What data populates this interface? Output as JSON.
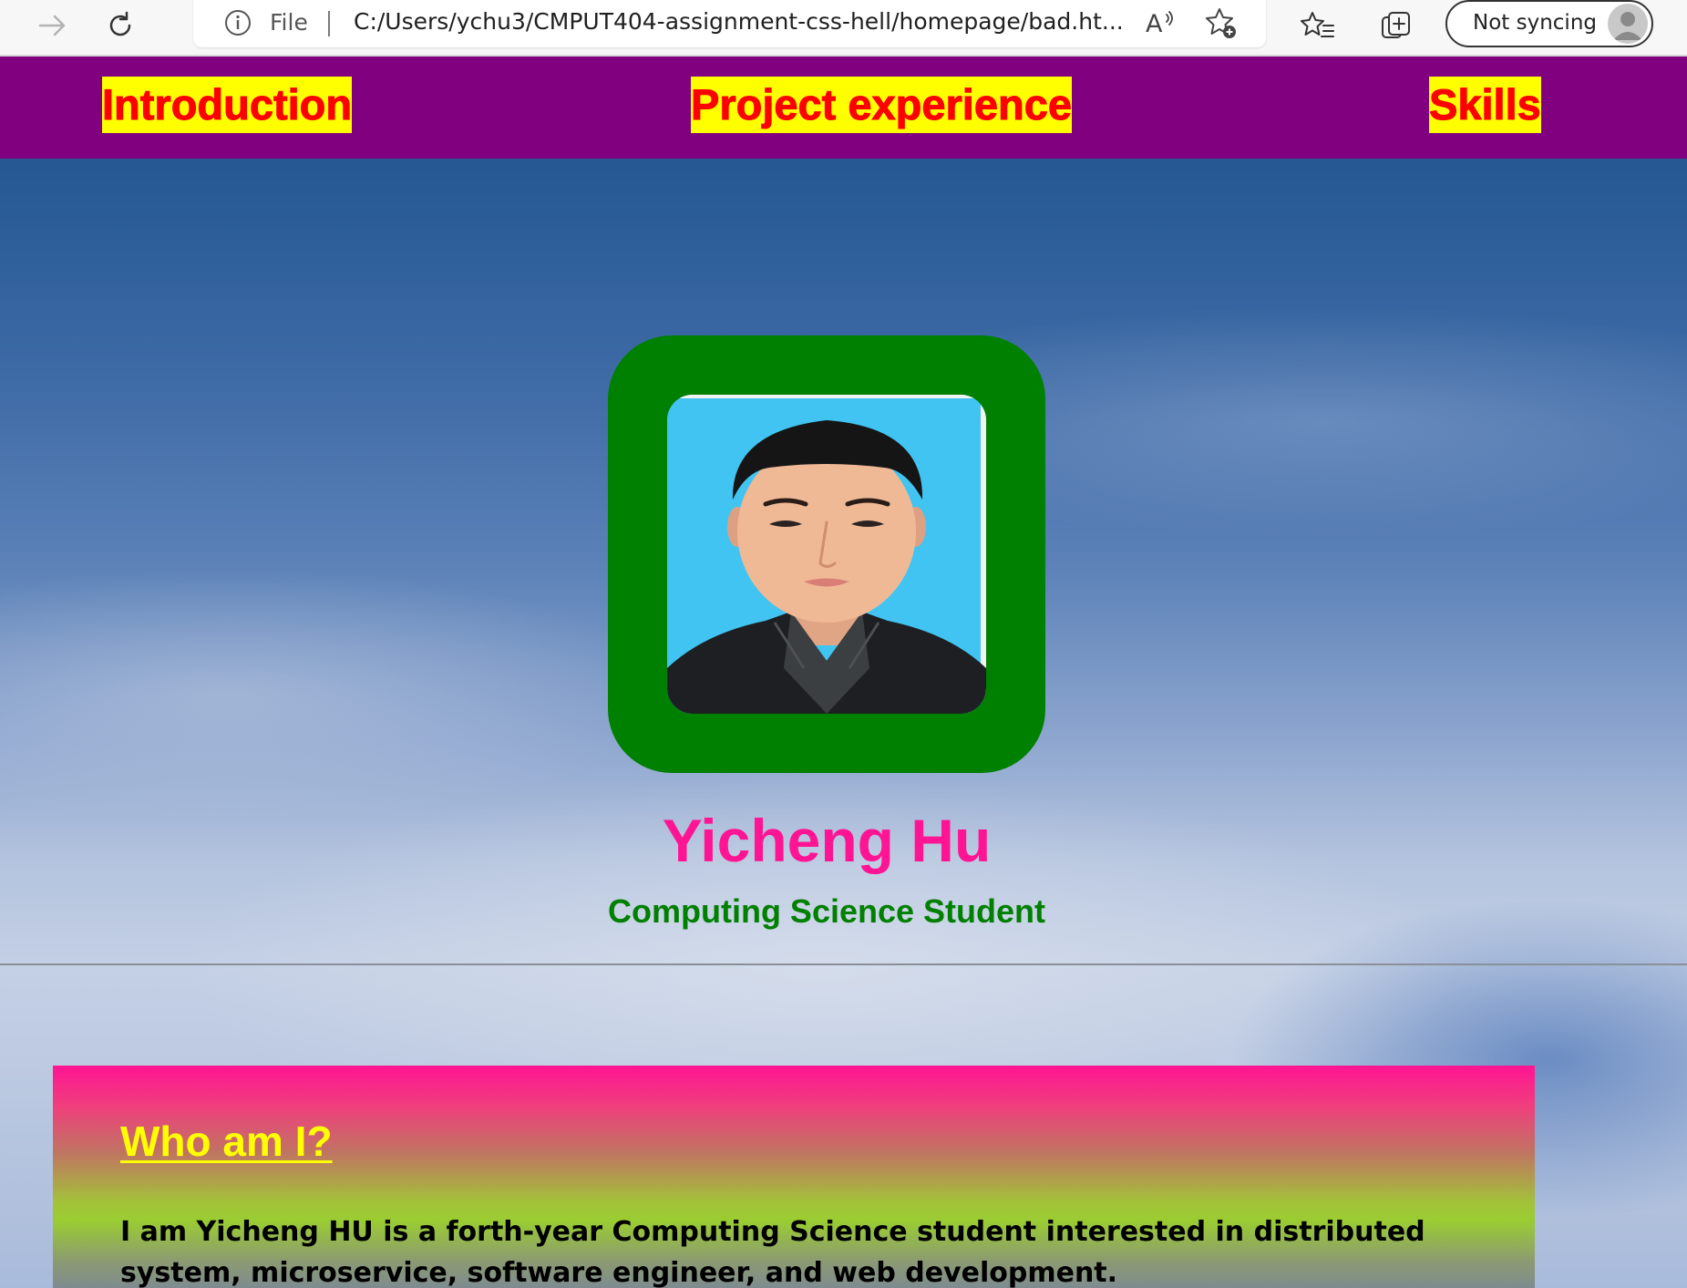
{
  "browser": {
    "file_label": "File",
    "url": "C:/Users/ychu3/CMPUT404-assignment-css-hell/homepage/bad.ht...",
    "sync_label": "Not syncing",
    "icons": [
      "forward-arrow-icon",
      "refresh-icon",
      "info-icon",
      "read-aloud-icon",
      "add-favorite-icon",
      "favorites-icon",
      "collections-icon",
      "profile-avatar-icon"
    ]
  },
  "nav": {
    "items": [
      {
        "label": "Introduction"
      },
      {
        "label": "Project experience"
      },
      {
        "label": "Skills"
      }
    ]
  },
  "profile": {
    "name": "Yicheng Hu",
    "subtitle": "Computing Science Student"
  },
  "about": {
    "heading": "Who am I?",
    "text": "I am Yicheng HU is a forth-year Computing Science student interested in distributed system, microservice, software engineer, and web development."
  },
  "colors": {
    "nav_background": "#800080",
    "nav_link_background": "#ffff00",
    "nav_link_text": "#ff0000",
    "photo_frame": "#008000",
    "name_text": "#ff1493",
    "subtitle_text": "#008000",
    "about_heading": "#ffff00"
  }
}
